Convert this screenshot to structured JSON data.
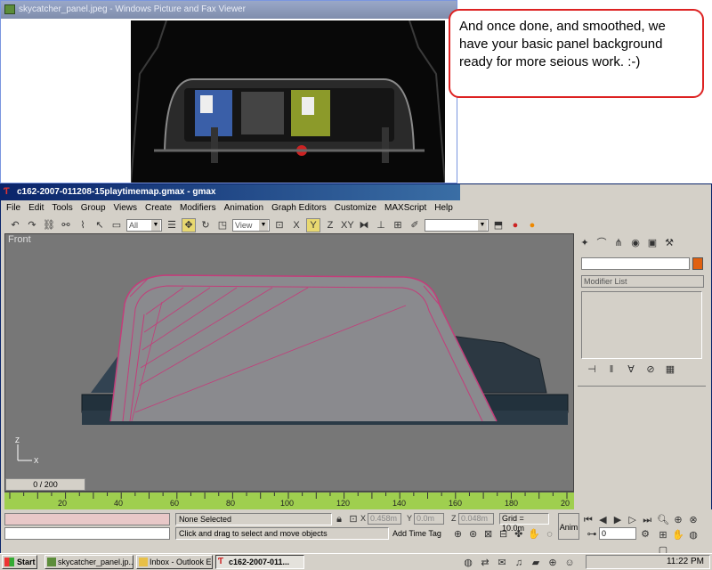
{
  "viewer": {
    "title": "skycatcher_panel.jpeg - Windows Picture and Fax Viewer"
  },
  "callout": {
    "text": "And once done, and smoothed, we have your basic panel background ready for more seious work. :-)"
  },
  "gmax": {
    "title": "c162-2007-011208-15playtimemap.gmax - gmax",
    "menu": [
      "File",
      "Edit",
      "Tools",
      "Group",
      "Views",
      "Create",
      "Modifiers",
      "Animation",
      "Graph Editors",
      "Customize",
      "MAXScript",
      "Help"
    ],
    "toolbar": {
      "selection_filter": "All",
      "ref_coord": "View"
    },
    "viewport": {
      "label": "Front"
    },
    "panel": {
      "modifier_list": "Modifier List"
    },
    "time_slider": "0 / 200",
    "ruler_ticks": [
      "20",
      "40",
      "60",
      "80",
      "100",
      "120",
      "140",
      "160",
      "180",
      "20"
    ],
    "status": {
      "selection": "None Selected",
      "prompt": "Click and drag to select and move objects",
      "x_label": "X",
      "x_value": "0.458m",
      "y_label": "Y",
      "y_value": "0.0m",
      "z_label": "Z",
      "z_value": "0.048m",
      "grid": "Grid = 10.0m",
      "add_time_tag": "Add Time Tag",
      "anim": "Anim",
      "frame": "0"
    }
  },
  "taskbar": {
    "start": "Start",
    "items": [
      "skycatcher_panel.jp...",
      "Inbox - Outlook E...",
      "c162-2007-011..."
    ],
    "clock": "11:22 PM"
  }
}
